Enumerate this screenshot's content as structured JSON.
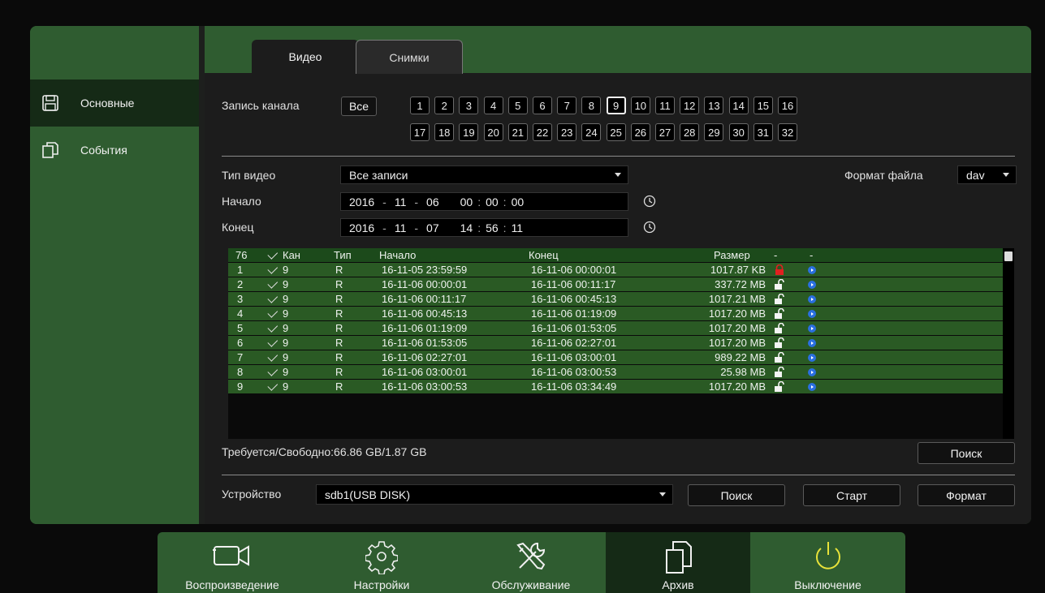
{
  "sidebar": {
    "items": [
      {
        "label": "Основные",
        "icon": "save-icon"
      },
      {
        "label": "События",
        "icon": "copy-icon"
      }
    ]
  },
  "tabs": [
    {
      "label": "Видео"
    },
    {
      "label": "Снимки"
    }
  ],
  "channel": {
    "label": "Запись канала",
    "all_label": "Все",
    "numbers": [
      "1",
      "2",
      "3",
      "4",
      "5",
      "6",
      "7",
      "8",
      "9",
      "10",
      "11",
      "12",
      "13",
      "14",
      "15",
      "16",
      "17",
      "18",
      "19",
      "20",
      "21",
      "22",
      "23",
      "24",
      "25",
      "26",
      "27",
      "28",
      "29",
      "30",
      "31",
      "32"
    ],
    "selected": "9"
  },
  "filters": {
    "video_type_label": "Тип видео",
    "video_type_value": "Все записи",
    "file_format_label": "Формат файла",
    "file_format_value": "dav",
    "start_label": "Начало",
    "start": {
      "year": "2016",
      "month": "11",
      "day": "06",
      "h": "00",
      "m": "00",
      "s": "00"
    },
    "end_label": "Конец",
    "end": {
      "year": "2016",
      "month": "11",
      "day": "07",
      "h": "14",
      "m": "56",
      "s": "11"
    }
  },
  "table": {
    "headers": {
      "count": "76",
      "ch": "Кан",
      "type": "Тип",
      "start": "Начало",
      "end": "Конец",
      "size": "Размер",
      "lock": "-",
      "play": "-"
    },
    "rows": [
      {
        "n": "1",
        "ch": "9",
        "type": "R",
        "start": "16-11-05 23:59:59",
        "end": "16-11-06 00:00:01",
        "size": "1017.87 KB",
        "locked": true
      },
      {
        "n": "2",
        "ch": "9",
        "type": "R",
        "start": "16-11-06 00:00:01",
        "end": "16-11-06 00:11:17",
        "size": "337.72 MB",
        "locked": false
      },
      {
        "n": "3",
        "ch": "9",
        "type": "R",
        "start": "16-11-06 00:11:17",
        "end": "16-11-06 00:45:13",
        "size": "1017.21 MB",
        "locked": false
      },
      {
        "n": "4",
        "ch": "9",
        "type": "R",
        "start": "16-11-06 00:45:13",
        "end": "16-11-06 01:19:09",
        "size": "1017.20 MB",
        "locked": false
      },
      {
        "n": "5",
        "ch": "9",
        "type": "R",
        "start": "16-11-06 01:19:09",
        "end": "16-11-06 01:53:05",
        "size": "1017.20 MB",
        "locked": false
      },
      {
        "n": "6",
        "ch": "9",
        "type": "R",
        "start": "16-11-06 01:53:05",
        "end": "16-11-06 02:27:01",
        "size": "1017.20 MB",
        "locked": false
      },
      {
        "n": "7",
        "ch": "9",
        "type": "R",
        "start": "16-11-06 02:27:01",
        "end": "16-11-06 03:00:01",
        "size": "989.22 MB",
        "locked": false
      },
      {
        "n": "8",
        "ch": "9",
        "type": "R",
        "start": "16-11-06 03:00:01",
        "end": "16-11-06 03:00:53",
        "size": "25.98 MB",
        "locked": false
      },
      {
        "n": "9",
        "ch": "9",
        "type": "R",
        "start": "16-11-06 03:00:53",
        "end": "16-11-06 03:34:49",
        "size": "1017.20 MB",
        "locked": false
      }
    ]
  },
  "storage": {
    "required_free": "Требуется/Свободно:66.86 GB/1.87 GB",
    "search_label": "Поиск"
  },
  "device": {
    "label": "Устройство",
    "value": "sdb1(USB DISK)",
    "search_label": "Поиск",
    "start_label": "Старт",
    "format_label": "Формат"
  },
  "bottom_nav": [
    {
      "label": "Воспроизведение",
      "icon": "camera-icon"
    },
    {
      "label": "Настройки",
      "icon": "gear-icon"
    },
    {
      "label": "Обслуживание",
      "icon": "tools-icon"
    },
    {
      "label": "Архив",
      "icon": "copy-icon"
    },
    {
      "label": "Выключение",
      "icon": "power-icon"
    }
  ],
  "colors": {
    "panel_green": "#2f5c30",
    "row_green": "#2a5a24",
    "power_yellow": "#e8e23a",
    "lock_red": "#e02020",
    "play_blue": "#2a6fe0"
  }
}
